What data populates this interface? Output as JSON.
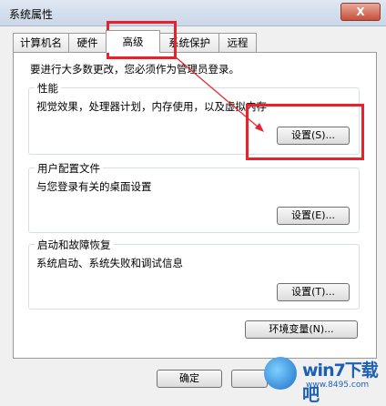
{
  "window": {
    "title": "系统属性",
    "close_label": "X"
  },
  "tabs": [
    {
      "label": "计算机名"
    },
    {
      "label": "硬件"
    },
    {
      "label": "高级"
    },
    {
      "label": "系统保护"
    },
    {
      "label": "远程"
    }
  ],
  "admin_note": "要进行大多数更改，您必须作为管理员登录。",
  "performance": {
    "title": "性能",
    "desc": "视觉效果，处理器计划，内存使用，以及虚拟内存",
    "button": "设置(S)..."
  },
  "user_profiles": {
    "title": "用户配置文件",
    "desc": "与您登录有关的桌面设置",
    "button": "设置(E)..."
  },
  "startup_recovery": {
    "title": "启动和故障恢复",
    "desc": "系统启动、系统失败和调试信息",
    "button": "设置(T)..."
  },
  "env_button": "环境变量(N)...",
  "footer": {
    "ok": "确定"
  },
  "watermark": {
    "brand": "win7下载吧",
    "url": "www.8495.com"
  },
  "colors": {
    "highlight": "#e8212b"
  }
}
